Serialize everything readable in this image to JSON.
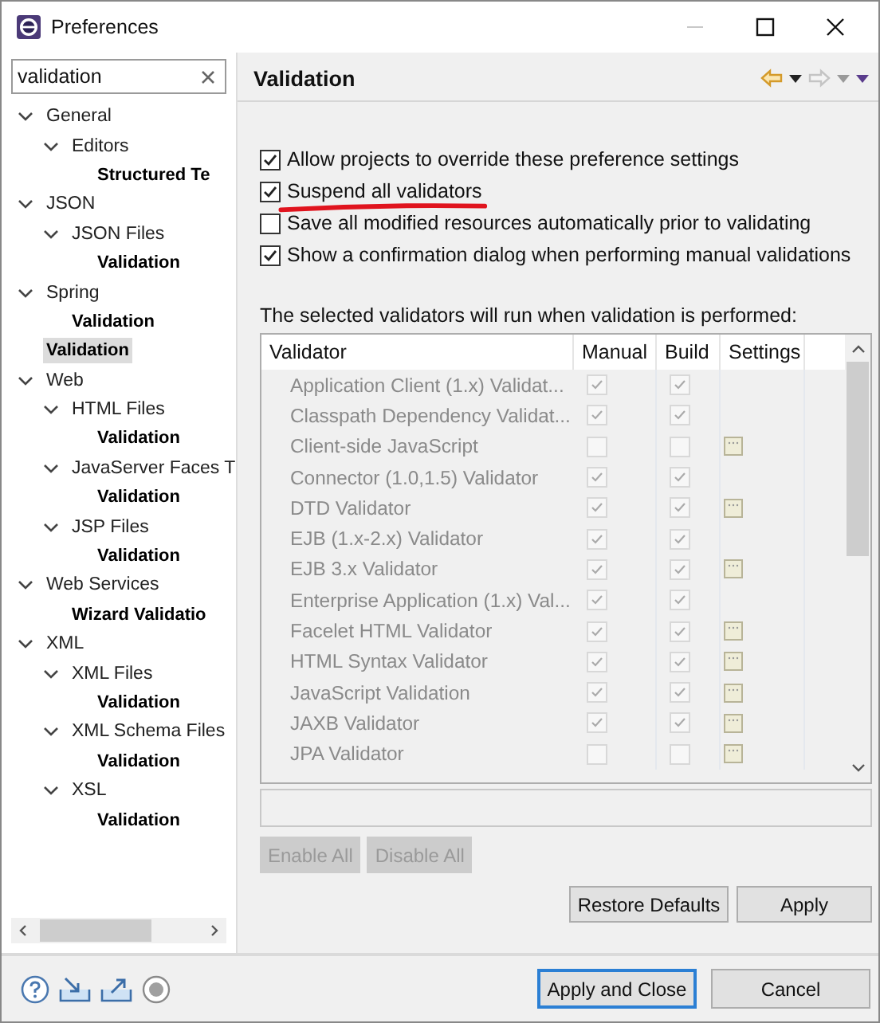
{
  "window": {
    "title": "Preferences"
  },
  "filter": {
    "value": "validation"
  },
  "tree": [
    {
      "label": "General",
      "bold": false,
      "selected": false,
      "expanded": true,
      "children": [
        {
          "label": "Editors",
          "bold": false,
          "selected": false,
          "expanded": true,
          "children": [
            {
              "label": "Structured Te",
              "bold": true,
              "selected": false
            }
          ]
        }
      ]
    },
    {
      "label": "JSON",
      "bold": false,
      "selected": false,
      "expanded": true,
      "children": [
        {
          "label": "JSON Files",
          "bold": false,
          "selected": false,
          "expanded": true,
          "children": [
            {
              "label": "Validation",
              "bold": true,
              "selected": false
            }
          ]
        }
      ]
    },
    {
      "label": "Spring",
      "bold": false,
      "selected": false,
      "expanded": true,
      "children": [
        {
          "label": "Validation",
          "bold": true,
          "selected": false
        }
      ]
    },
    {
      "label": "Validation",
      "bold": true,
      "selected": true
    },
    {
      "label": "Web",
      "bold": false,
      "selected": false,
      "expanded": true,
      "children": [
        {
          "label": "HTML Files",
          "bold": false,
          "selected": false,
          "expanded": true,
          "children": [
            {
              "label": "Validation",
              "bold": true,
              "selected": false
            }
          ]
        },
        {
          "label": "JavaServer Faces T",
          "bold": false,
          "selected": false,
          "expanded": true,
          "children": [
            {
              "label": "Validation",
              "bold": true,
              "selected": false
            }
          ]
        },
        {
          "label": "JSP Files",
          "bold": false,
          "selected": false,
          "expanded": true,
          "children": [
            {
              "label": "Validation",
              "bold": true,
              "selected": false
            }
          ]
        }
      ]
    },
    {
      "label": "Web Services",
      "bold": false,
      "selected": false,
      "expanded": true,
      "children": [
        {
          "label": "Wizard Validatio",
          "bold": true,
          "selected": false
        }
      ]
    },
    {
      "label": "XML",
      "bold": false,
      "selected": false,
      "expanded": true,
      "children": [
        {
          "label": "XML Files",
          "bold": false,
          "selected": false,
          "expanded": true,
          "children": [
            {
              "label": "Validation",
              "bold": true,
              "selected": false
            }
          ]
        },
        {
          "label": "XML Schema Files",
          "bold": false,
          "selected": false,
          "expanded": true,
          "children": [
            {
              "label": "Validation",
              "bold": true,
              "selected": false
            }
          ]
        },
        {
          "label": "XSL",
          "bold": false,
          "selected": false,
          "expanded": true,
          "children": [
            {
              "label": "Validation",
              "bold": true,
              "selected": false
            }
          ]
        }
      ]
    }
  ],
  "page": {
    "title": "Validation"
  },
  "options": [
    {
      "label": "Allow projects to override these preference settings",
      "checked": true,
      "underlined": false
    },
    {
      "label": "Suspend all validators",
      "checked": true,
      "underlined": true
    },
    {
      "label": "Save all modified resources automatically prior to validating",
      "checked": false,
      "underlined": false
    },
    {
      "label": "Show a confirmation dialog when performing manual validations",
      "checked": true,
      "underlined": false
    }
  ],
  "table_caption": "The selected validators will run when validation is performed:",
  "table": {
    "disabled": true,
    "columns": [
      "Validator",
      "Manual",
      "Build",
      "Settings"
    ],
    "rows": [
      {
        "name": "Application Client (1.x) Validat...",
        "manual": true,
        "build": true,
        "settings": false
      },
      {
        "name": "Classpath Dependency Validat...",
        "manual": true,
        "build": true,
        "settings": false
      },
      {
        "name": "Client-side JavaScript",
        "manual": false,
        "build": false,
        "settings": true
      },
      {
        "name": "Connector (1.0,1.5) Validator",
        "manual": true,
        "build": true,
        "settings": false
      },
      {
        "name": "DTD Validator",
        "manual": true,
        "build": true,
        "settings": true
      },
      {
        "name": "EJB (1.x-2.x) Validator",
        "manual": true,
        "build": true,
        "settings": false
      },
      {
        "name": "EJB 3.x Validator",
        "manual": true,
        "build": true,
        "settings": true
      },
      {
        "name": "Enterprise Application (1.x) Val...",
        "manual": true,
        "build": true,
        "settings": false
      },
      {
        "name": "Facelet HTML Validator",
        "manual": true,
        "build": true,
        "settings": true
      },
      {
        "name": "HTML Syntax Validator",
        "manual": true,
        "build": true,
        "settings": true
      },
      {
        "name": "JavaScript Validation",
        "manual": true,
        "build": true,
        "settings": true
      },
      {
        "name": "JAXB Validator",
        "manual": true,
        "build": true,
        "settings": true
      },
      {
        "name": "JPA Validator",
        "manual": false,
        "build": false,
        "settings": true
      }
    ]
  },
  "table_buttons": [
    {
      "label": "Enable All",
      "disabled": true
    },
    {
      "label": "Disable All",
      "disabled": true
    }
  ],
  "page_buttons": [
    {
      "label": "Restore Defaults"
    },
    {
      "label": "Apply"
    }
  ],
  "dialog_buttons": [
    {
      "label": "Apply and Close",
      "default": true
    },
    {
      "label": "Cancel",
      "default": false
    }
  ]
}
